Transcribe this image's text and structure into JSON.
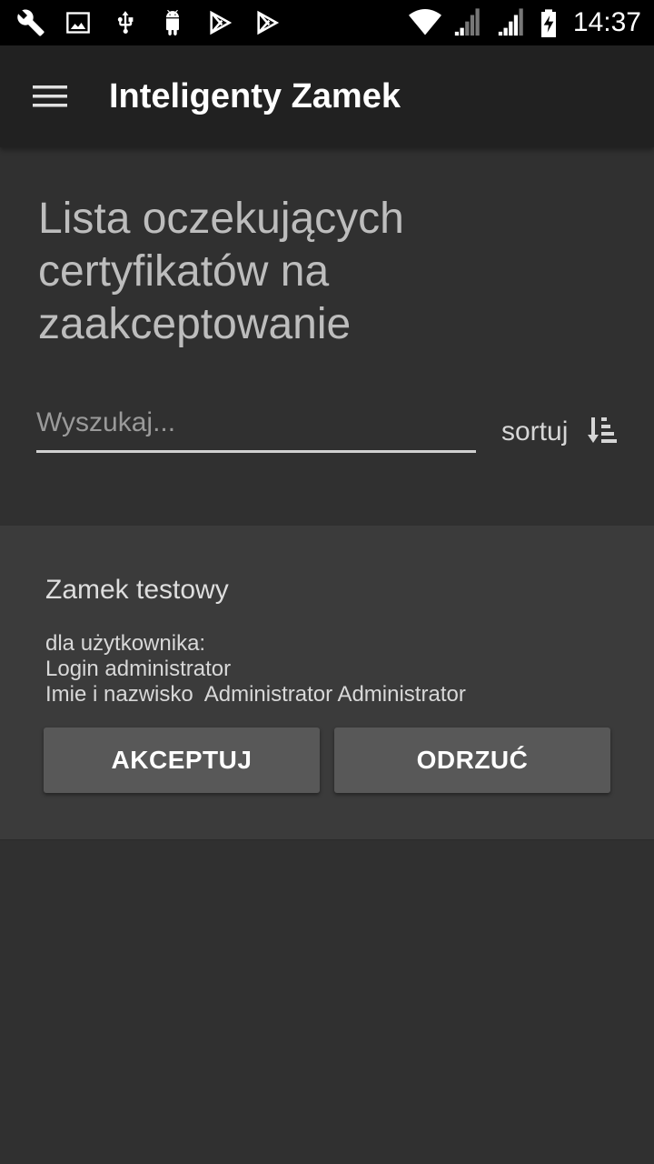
{
  "status_bar": {
    "time": "14:37",
    "left_icons": [
      "wrench-icon",
      "image-icon",
      "usb-icon",
      "android-icon",
      "play-store-icon",
      "play-store-icon"
    ],
    "right_icons": [
      "wifi-icon",
      "signal-icon",
      "signal-icon",
      "battery-charging-icon"
    ]
  },
  "app_bar": {
    "title": "Inteligenty Zamek",
    "menu_icon": "hamburger-menu-icon"
  },
  "page": {
    "title": "Lista oczekujących certyfikatów na zaakceptowanie",
    "search_placeholder": "Wyszukaj...",
    "search_value": "",
    "sort_label": "sortuj",
    "sort_icon": "sort-descending-icon"
  },
  "certificates": [
    {
      "lock_name": "Zamek testowy",
      "for_user_label": "dla użytkownika:",
      "login_line": "Login administrator",
      "name_line": "Imie i nazwisko  Administrator Administrator",
      "accept_label": "AKCEPTUJ",
      "reject_label": "ODRZUĆ"
    }
  ],
  "colors": {
    "status_bar": "#000000",
    "app_bar": "#212121",
    "background": "#303030",
    "card": "#3b3b3b",
    "button": "#585858"
  }
}
